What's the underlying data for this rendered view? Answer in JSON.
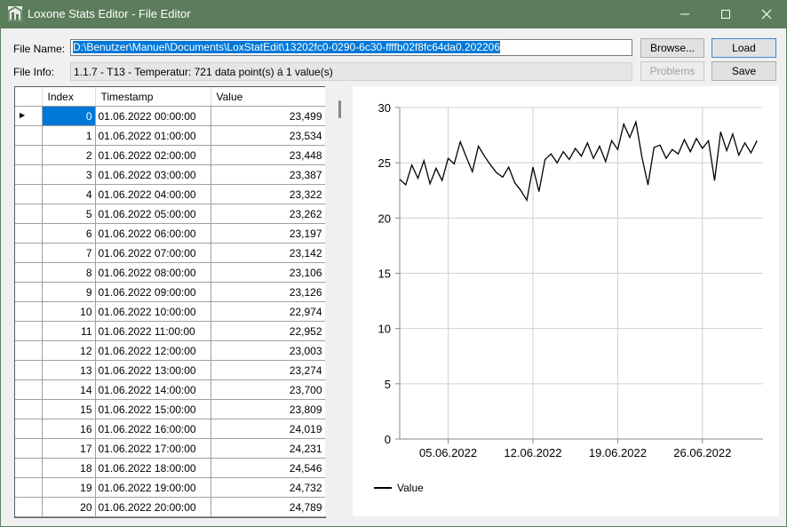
{
  "window": {
    "title": "Loxone Stats Editor - File Editor"
  },
  "form": {
    "file_name_label": "File Name:",
    "file_path": "D:\\Benutzer\\Manuel\\Documents\\LoxStatEdit\\13202fc0-0290-6c30-ffffb02f8fc64da0.202206",
    "file_info_label": "File Info:",
    "file_info": "1.1.7 - T13 - Temperatur: 721 data point(s) á 1 value(s)"
  },
  "buttons": {
    "browse": "Browse...",
    "load": "Load",
    "problems": "Problems",
    "save": "Save"
  },
  "grid": {
    "columns": [
      "Index",
      "Timestamp",
      "Value"
    ],
    "rows": [
      [
        "0",
        "01.06.2022 00:00:00",
        "23,499"
      ],
      [
        "1",
        "01.06.2022 01:00:00",
        "23,534"
      ],
      [
        "2",
        "01.06.2022 02:00:00",
        "23,448"
      ],
      [
        "3",
        "01.06.2022 03:00:00",
        "23,387"
      ],
      [
        "4",
        "01.06.2022 04:00:00",
        "23,322"
      ],
      [
        "5",
        "01.06.2022 05:00:00",
        "23,262"
      ],
      [
        "6",
        "01.06.2022 06:00:00",
        "23,197"
      ],
      [
        "7",
        "01.06.2022 07:00:00",
        "23,142"
      ],
      [
        "8",
        "01.06.2022 08:00:00",
        "23,106"
      ],
      [
        "9",
        "01.06.2022 09:00:00",
        "23,126"
      ],
      [
        "10",
        "01.06.2022 10:00:00",
        "22,974"
      ],
      [
        "11",
        "01.06.2022 11:00:00",
        "22,952"
      ],
      [
        "12",
        "01.06.2022 12:00:00",
        "23,003"
      ],
      [
        "13",
        "01.06.2022 13:00:00",
        "23,274"
      ],
      [
        "14",
        "01.06.2022 14:00:00",
        "23,700"
      ],
      [
        "15",
        "01.06.2022 15:00:00",
        "23,809"
      ],
      [
        "16",
        "01.06.2022 16:00:00",
        "24,019"
      ],
      [
        "17",
        "01.06.2022 17:00:00",
        "24,231"
      ],
      [
        "18",
        "01.06.2022 18:00:00",
        "24,546"
      ],
      [
        "19",
        "01.06.2022 19:00:00",
        "24,732"
      ],
      [
        "20",
        "01.06.2022 20:00:00",
        "24,789"
      ]
    ],
    "selected_row": 0,
    "current_row_marker": "▶"
  },
  "chart_data": {
    "type": "line",
    "title": "",
    "xlabel": "",
    "ylabel": "",
    "ylim": [
      0,
      30
    ],
    "yticks": [
      0,
      5,
      10,
      15,
      20,
      25,
      30
    ],
    "xlim": [
      "01.06.2022",
      "01.07.2022"
    ],
    "xticks": [
      "05.06.2022",
      "12.06.2022",
      "19.06.2022",
      "26.06.2022"
    ],
    "grid": true,
    "legend": "bottom-left",
    "series": [
      {
        "name": "Value",
        "color": "#000000",
        "x": [
          "01.06.2022",
          "01.06.2022 12:00",
          "02.06.2022",
          "02.06.2022 12:00",
          "03.06.2022",
          "03.06.2022 12:00",
          "04.06.2022",
          "04.06.2022 12:00",
          "05.06.2022",
          "05.06.2022 12:00",
          "06.06.2022",
          "06.06.2022 12:00",
          "07.06.2022",
          "07.06.2022 12:00",
          "08.06.2022",
          "08.06.2022 12:00",
          "09.06.2022",
          "09.06.2022 12:00",
          "10.06.2022",
          "10.06.2022 12:00",
          "11.06.2022",
          "11.06.2022 12:00",
          "12.06.2022",
          "12.06.2022 12:00",
          "13.06.2022",
          "13.06.2022 12:00",
          "14.06.2022",
          "14.06.2022 12:00",
          "15.06.2022",
          "15.06.2022 12:00",
          "16.06.2022",
          "16.06.2022 12:00",
          "17.06.2022",
          "17.06.2022 12:00",
          "18.06.2022",
          "18.06.2022 12:00",
          "19.06.2022",
          "19.06.2022 12:00",
          "20.06.2022",
          "20.06.2022 12:00",
          "21.06.2022",
          "21.06.2022 12:00",
          "22.06.2022",
          "22.06.2022 12:00",
          "23.06.2022",
          "23.06.2022 12:00",
          "24.06.2022",
          "24.06.2022 12:00",
          "25.06.2022",
          "25.06.2022 12:00",
          "26.06.2022",
          "26.06.2022 12:00",
          "27.06.2022",
          "27.06.2022 12:00",
          "28.06.2022",
          "28.06.2022 12:00",
          "29.06.2022",
          "29.06.2022 12:00",
          "30.06.2022",
          "30.06.2022 12:00"
        ],
        "values": [
          23.5,
          23.0,
          24.8,
          23.6,
          25.2,
          23.1,
          24.5,
          23.4,
          25.4,
          24.9,
          26.9,
          25.5,
          24.2,
          26.5,
          25.6,
          24.8,
          24.1,
          23.7,
          24.6,
          23.2,
          22.5,
          21.6,
          24.6,
          22.4,
          25.3,
          25.8,
          25.0,
          26.0,
          25.3,
          26.3,
          25.6,
          26.8,
          25.4,
          26.5,
          25.1,
          27.0,
          26.2,
          28.5,
          27.3,
          28.7,
          25.5,
          23.0,
          26.4,
          26.6,
          25.4,
          26.2,
          25.8,
          27.1,
          26.0,
          27.2,
          26.3,
          27.0,
          23.4,
          27.8,
          26.1,
          27.6,
          25.7,
          26.8,
          25.9,
          27.0
        ]
      }
    ]
  }
}
